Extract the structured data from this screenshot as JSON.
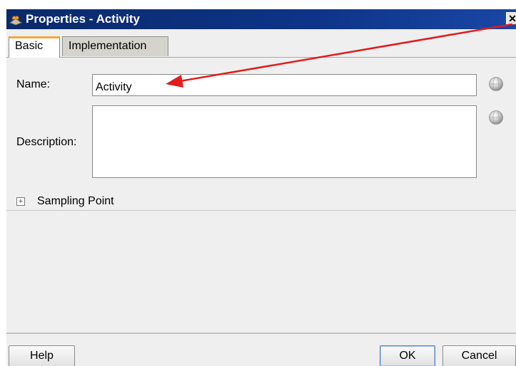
{
  "window": {
    "title": "Properties - Activity",
    "close_glyph": "✕"
  },
  "tabs": [
    {
      "label": "Basic",
      "selected": true
    },
    {
      "label": "Implementation",
      "selected": false
    }
  ],
  "form": {
    "name_label": "Name:",
    "name_value": "Activity",
    "description_label": "Description:",
    "description_value": ""
  },
  "section": {
    "expand_glyph": "+",
    "label": "Sampling Point"
  },
  "buttons": {
    "help": "Help",
    "ok": "OK",
    "cancel": "Cancel"
  },
  "icons": {
    "title_icon": "properties-app-icon",
    "translate": "globe-icon",
    "annotation": "red-arrow-icon"
  },
  "colors": {
    "titlebar": "#0d3488",
    "active_tab_accent": "#f4a83a",
    "annotation_arrow": "#e41b1b"
  }
}
